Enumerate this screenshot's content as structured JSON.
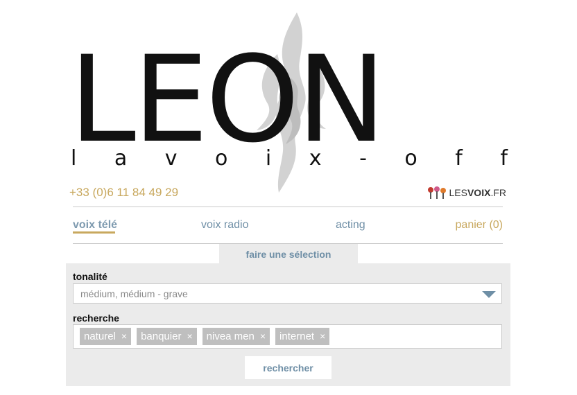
{
  "logo": {
    "wordmark": "LEON",
    "tagline": [
      "l",
      "a",
      "v",
      "o",
      "i",
      "x",
      "-",
      "o",
      "f",
      "f"
    ]
  },
  "contact": {
    "phone": "+33 (0)6 11 84 49 29"
  },
  "partner": {
    "prefix": "LES",
    "bold": "VOIX",
    "suffix": ".FR"
  },
  "nav": {
    "items": [
      {
        "label": "voix télé",
        "active": true
      },
      {
        "label": "voix radio"
      },
      {
        "label": "acting"
      },
      {
        "label": "panier (0)"
      }
    ]
  },
  "selection": {
    "tab_label": "faire une sélection",
    "tonalite_label": "tonalité",
    "tonalite_value": "médium, médium - grave",
    "recherche_label": "recherche",
    "tags": [
      "naturel",
      "banquier",
      "nivea men",
      "internet"
    ],
    "tag_remove": "×",
    "search_button": "rechercher"
  },
  "colors": {
    "gold": "#c8a85e",
    "blue": "#6f8fa6",
    "panel": "#ebebeb"
  }
}
